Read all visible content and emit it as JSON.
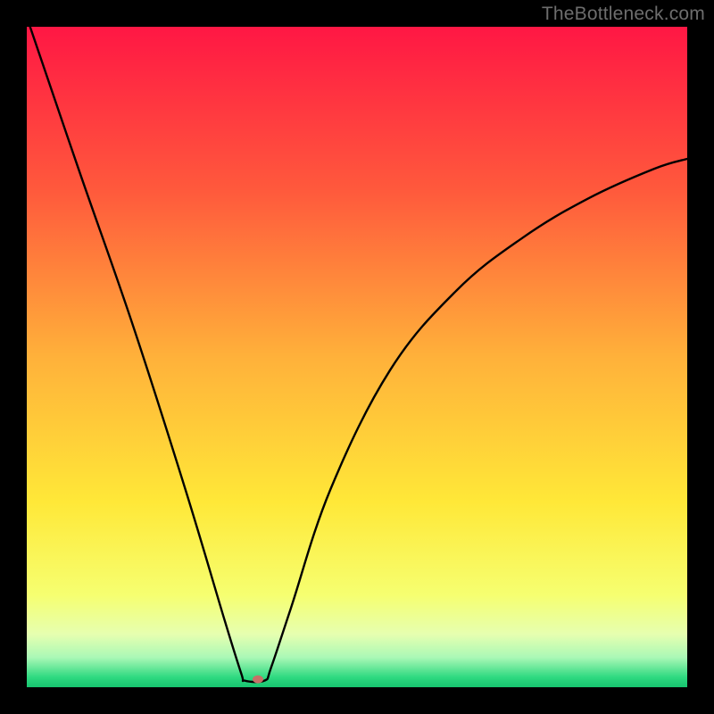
{
  "watermark": "TheBottleneck.com",
  "chart_data": {
    "type": "line",
    "title": "",
    "xlabel": "",
    "ylabel": "",
    "xlim": [
      0,
      100
    ],
    "ylim": [
      0,
      100
    ],
    "x_min_at": 34,
    "marker": {
      "x": 35,
      "y": 1.2,
      "color": "#c77067"
    },
    "curve_anchors": [
      {
        "x": 0.5,
        "y": 100
      },
      {
        "x": 8,
        "y": 78
      },
      {
        "x": 16,
        "y": 55
      },
      {
        "x": 24,
        "y": 30
      },
      {
        "x": 30,
        "y": 10
      },
      {
        "x": 32.5,
        "y": 2
      },
      {
        "x": 33,
        "y": 1
      },
      {
        "x": 36,
        "y": 1
      },
      {
        "x": 37,
        "y": 3
      },
      {
        "x": 40,
        "y": 12
      },
      {
        "x": 46,
        "y": 30
      },
      {
        "x": 55,
        "y": 48
      },
      {
        "x": 65,
        "y": 60
      },
      {
        "x": 75,
        "y": 68
      },
      {
        "x": 85,
        "y": 74
      },
      {
        "x": 95,
        "y": 78.5
      },
      {
        "x": 100,
        "y": 80
      }
    ],
    "gradient_stops": [
      {
        "offset": 0.0,
        "color": "#ff1744"
      },
      {
        "offset": 0.25,
        "color": "#ff5a3c"
      },
      {
        "offset": 0.5,
        "color": "#ffb13a"
      },
      {
        "offset": 0.72,
        "color": "#ffe838"
      },
      {
        "offset": 0.86,
        "color": "#f6ff70"
      },
      {
        "offset": 0.92,
        "color": "#e6ffb0"
      },
      {
        "offset": 0.955,
        "color": "#aaf8b6"
      },
      {
        "offset": 0.985,
        "color": "#2ed980"
      },
      {
        "offset": 1.0,
        "color": "#17c46f"
      }
    ]
  }
}
